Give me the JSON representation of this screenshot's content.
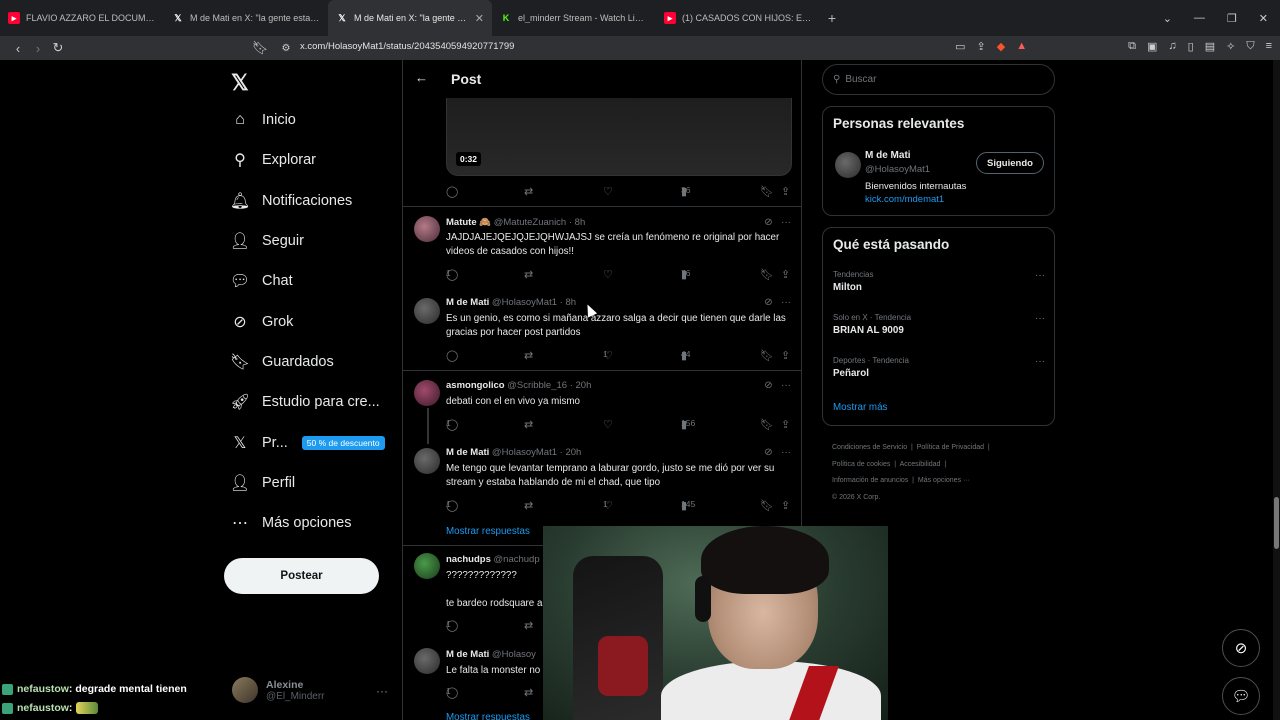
{
  "browser": {
    "tabs": [
      {
        "title": "FLAVIO AZZARO EL DOCUMENTAL -",
        "favicon": "youtube-icon",
        "active": false
      },
      {
        "title": "M de Mati en X: \"la gente esta re pin",
        "favicon": "x-icon",
        "active": false
      },
      {
        "title": "M de Mati en X: \"la gente esta re",
        "favicon": "x-icon",
        "active": true
      },
      {
        "title": "el_minderr Stream - Watch Live on K",
        "favicon": "kick-icon",
        "active": false
      },
      {
        "title": "(1) CASADOS CON HIJOS: El MEJOR C",
        "favicon": "youtube-icon",
        "active": false
      }
    ],
    "new_tab": "+",
    "url": "x.com/HolasoyMat1/status/2043540594920771799"
  },
  "nav": {
    "items": [
      {
        "label": "Inicio",
        "icon": "home-icon",
        "glyph": "⌂"
      },
      {
        "label": "Explorar",
        "icon": "search-icon",
        "glyph": "⚲"
      },
      {
        "label": "Notificaciones",
        "icon": "bell-icon",
        "glyph": "🔔︎"
      },
      {
        "label": "Seguir",
        "icon": "add-person-icon",
        "glyph": "👤︎"
      },
      {
        "label": "Chat",
        "icon": "chat-icon",
        "glyph": "💬︎"
      },
      {
        "label": "Grok",
        "icon": "grok-icon",
        "glyph": "⊘"
      },
      {
        "label": "Guardados",
        "icon": "bookmark-icon",
        "glyph": "🔖︎"
      },
      {
        "label": "Estudio para cre...",
        "icon": "rocket-icon",
        "glyph": "🚀︎"
      },
      {
        "label": "Pr...",
        "icon": "x-premium-icon",
        "glyph": "𝕏",
        "badge": "50 % de descuento"
      },
      {
        "label": "Perfil",
        "icon": "person-icon",
        "glyph": "👤︎"
      },
      {
        "label": "Más opciones",
        "icon": "more-circle-icon",
        "glyph": "⋯"
      }
    ],
    "post_button": "Postear",
    "account": {
      "name": "Alexine",
      "handle": "@El_Minderr"
    }
  },
  "post": {
    "header": "Post",
    "video_time": "0:32",
    "video_actions": {
      "views": "36"
    },
    "tweets": [
      {
        "name": "Matute 🙈",
        "handle": "@MatuteZuanich",
        "time": "· 8h",
        "text": "JAJDJAJEJQEJQJEJQHWJAJSJ se creía un fenómeno re original por hacer videos de casados con hijos!!",
        "replies": "1",
        "likes": "",
        "views": "76"
      },
      {
        "name": "M de Mati",
        "handle": "@HolasoyMat1",
        "time": "· 8h",
        "text": "Es un genio, es como si mañana azzaro salga a decir que tienen que darle las gracias por hacer post partidos",
        "replies": "",
        "likes": "1",
        "views": "44"
      },
      {
        "name": "asmongolico",
        "handle": "@Scribble_16",
        "time": "· 20h",
        "text": "debati con el en vivo ya mismo",
        "replies": "1",
        "likes": "",
        "views": "156"
      },
      {
        "name": "M de Mati",
        "handle": "@HolasoyMat1",
        "time": "· 20h",
        "text": "Me tengo que levantar temprano a laburar gordo, justo se me dió por ver su stream y estaba hablando de mi el chad, que tipo",
        "replies": "1",
        "likes": "1",
        "views": "145"
      },
      {
        "name": "nachudps",
        "handle": "@nachudp",
        "time": "",
        "text": "?????????????",
        "text2": "te bardeo rodsquare a",
        "replies": "1",
        "likes": "",
        "views": ""
      },
      {
        "name": "M de Mati",
        "handle": "@Holasoy",
        "time": "",
        "text": "Le falta la monster no",
        "replies": "1",
        "likes": "",
        "views": ""
      }
    ],
    "show_replies": "Mostrar respuestas"
  },
  "sidebar": {
    "search_placeholder": "Buscar",
    "relevant": {
      "title": "Personas relevantes",
      "name": "M de Mati",
      "handle": "@HolasoyMat1",
      "bio": "Bienvenidos internautas",
      "link": "kick.com/mdemat1",
      "follow_label": "Siguiendo"
    },
    "trends": {
      "title": "Qué está pasando",
      "items": [
        {
          "context": "Tendencias",
          "name": "Milton"
        },
        {
          "context": "Solo en X · Tendencia",
          "name": "BRIAN AL 9009"
        },
        {
          "context": "Deportes · Tendencia",
          "name": "Peñarol"
        }
      ],
      "show_more": "Mostrar más"
    },
    "footer": {
      "line1a": "Condiciones de Servicio",
      "line1b": "Política de Privacidad",
      "line2a": "Política de cookies",
      "line2b": "Accesibilidad",
      "line3a": "Información de anuncios",
      "line3b": "Más opciones ···",
      "copyright": "© 2026 X Corp."
    }
  },
  "stream_chat": [
    {
      "user": "nefaustow",
      "message": ": degrade mental tienen"
    },
    {
      "user": "nefaustow",
      "message": ":"
    }
  ],
  "colors": {
    "accent": "#1d9bf0",
    "background": "#000000",
    "border": "#2f3336"
  }
}
